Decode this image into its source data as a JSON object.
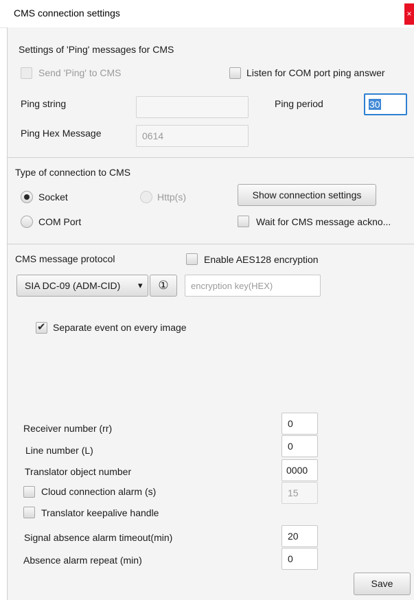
{
  "window": {
    "title": "CMS connection settings",
    "close_glyph": "×"
  },
  "ping": {
    "section_title": "Settings of 'Ping' messages for CMS",
    "send_ping_label": "Send 'Ping' to CMS",
    "send_ping_checked": false,
    "listen_label": "Listen for COM port ping answer",
    "listen_checked": false,
    "ping_string_label": "Ping string",
    "ping_string_value": "",
    "ping_period_label": "Ping period",
    "ping_period_value": "30",
    "hex_label": "Ping Hex Message",
    "hex_value": "0614"
  },
  "connection": {
    "section_title": "Type of connection to CMS",
    "socket_label": "Socket",
    "http_label": "Http(s)",
    "com_label": "COM Port",
    "selected": "Socket",
    "show_settings_label": "Show connection settings",
    "wait_ack_label": "Wait for CMS message ackno...",
    "wait_ack_checked": false
  },
  "protocol": {
    "section_title": "CMS message protocol",
    "aes_label": "Enable AES128 encryption",
    "aes_checked": false,
    "protocol_value": "SIA DC-09 (ADM-CID)",
    "dropdown_arrow": "▾",
    "info_glyph": "①",
    "key_placeholder": "encryption key(HEX)",
    "separate_event_label": "Separate event on every image",
    "separate_event_checked": true,
    "check_glyph": "✔"
  },
  "numbers": {
    "receiver_label": "Receiver number (rr)",
    "receiver_value": "0",
    "line_label": "Line number (L)",
    "line_value": "0",
    "translator_label": "Translator object number",
    "translator_value": "0000",
    "cloud_label": "Cloud connection alarm (s)",
    "cloud_checked": false,
    "cloud_value": "15",
    "keepalive_label": "Translator keepalive handle",
    "keepalive_checked": false,
    "signal_label": "Signal absence alarm timeout(min)",
    "signal_value": "20",
    "repeat_label": "Absence alarm repeat (min)",
    "repeat_value": "0"
  },
  "footer": {
    "save_label": "Save"
  },
  "colors": {
    "accent": "#2d7fd0",
    "close": "#e81123",
    "panel": "#f4f4f4"
  }
}
